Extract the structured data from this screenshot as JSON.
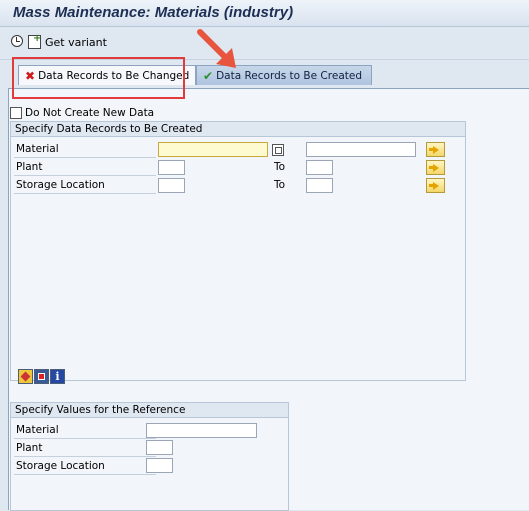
{
  "window": {
    "title": "Mass Maintenance: Materials (industry)"
  },
  "toolbar": {
    "get_variant_label": "Get variant"
  },
  "tabs": [
    {
      "label": "Data Records to Be Changed",
      "icon": "x-icon",
      "active": true
    },
    {
      "label": "Data Records to Be Created",
      "icon": "checkmark-icon",
      "active": false
    }
  ],
  "options": {
    "do_not_create_label": "Do Not Create New Data",
    "do_not_create_checked": false
  },
  "group_create": {
    "title": "Specify Data Records to Be Created",
    "to_label": "To",
    "rows": [
      {
        "label": "Material",
        "from_value": "",
        "to_value": ""
      },
      {
        "label": "Plant",
        "from_value": "",
        "to_value": ""
      },
      {
        "label": "Storage Location",
        "from_value": "",
        "to_value": ""
      }
    ]
  },
  "group_reference": {
    "title": "Specify Values for the Reference",
    "rows": [
      {
        "label": "Material",
        "value": ""
      },
      {
        "label": "Plant",
        "value": ""
      },
      {
        "label": "Storage Location",
        "value": ""
      }
    ]
  },
  "colors": {
    "highlight": "#e23b3b",
    "arrow": "#e8553f",
    "focus_field": "#fffbd0"
  }
}
